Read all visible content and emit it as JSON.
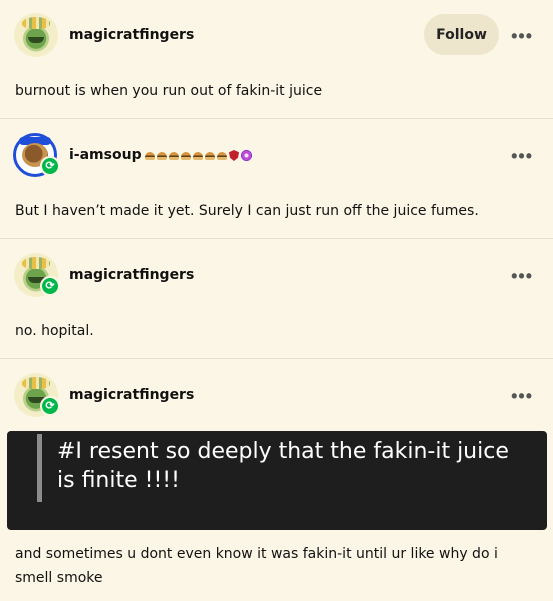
{
  "posts": [
    {
      "username": "magicratfingers",
      "follow_label": "Follow",
      "more_label": "•••",
      "text": "burnout is when you run out of fakin-it juice"
    },
    {
      "username": "i-amsoup",
      "more_label": "•••",
      "reblog_icon": "reblog-icon",
      "text": "But I haven’t made it yet. Surely I can just run off the juice fumes."
    },
    {
      "username": "magicratfingers",
      "more_label": "•••",
      "reblog_icon": "reblog-icon",
      "text": "no. hopital."
    },
    {
      "username": "magicratfingers",
      "more_label": "•••",
      "reblog_icon": "reblog-icon",
      "quote": "#I resent so deeply that the fakin-it juice is finite !!!!",
      "text": "and sometimes u dont even know it was fakin-it until ur like why do i smell smoke"
    }
  ],
  "colors": {
    "background": "#fbf6e5",
    "reblog_badge": "#00b84a",
    "quote_background": "#1e1e1e"
  }
}
